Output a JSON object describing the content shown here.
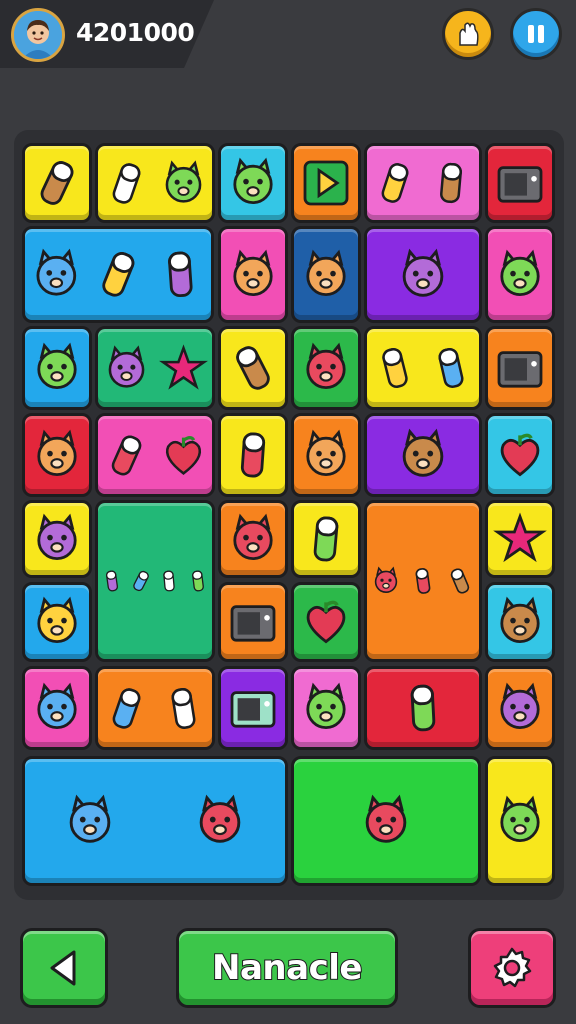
{
  "header": {
    "score": "4201000",
    "avatar_icon": "player-avatar",
    "boost_icon": "flame-hand-icon",
    "pause_icon": "pause-icon"
  },
  "colors": {
    "yellow": "#f8e71c",
    "cyan": "#34c6e6",
    "orange": "#f7831e",
    "pink": "#f06bd1",
    "red": "#e3263b",
    "blue": "#23a8ec",
    "magenta": "#f24fb5",
    "navy": "#1f5fa8",
    "purple": "#8a2be2",
    "green": "#2cb94a",
    "teal": "#22b877",
    "lime": "#2ad23e"
  },
  "tiles": [
    {
      "name": "tile-fan-yellow",
      "color": "yellow",
      "icons": [
        "fan-icon"
      ]
    },
    {
      "name": "tile-glove-ghost-yellow",
      "color": "yellow",
      "icons": [
        "glove-icon",
        "ghost-icon"
      ]
    },
    {
      "name": "tile-octopus-cyan",
      "color": "cyan",
      "icons": [
        "octopus-icon"
      ]
    },
    {
      "name": "tile-play-orange",
      "color": "orange",
      "icons": [
        "play-icon"
      ]
    },
    {
      "name": "tile-bottles-pink",
      "color": "pink",
      "icons": [
        "spray-bottle-icon",
        "battery-icon"
      ]
    },
    {
      "name": "tile-radio-red",
      "color": "red",
      "icons": [
        "radio-icon"
      ]
    },
    {
      "name": "tile-cat-tools-blue",
      "color": "blue",
      "icons": [
        "cat-icon",
        "fork-icon",
        "lollipop-icon"
      ]
    },
    {
      "name": "tile-frog-magenta",
      "color": "magenta",
      "icons": [
        "frog-icon"
      ]
    },
    {
      "name": "tile-bird-navy",
      "color": "navy",
      "icons": [
        "bird-icon"
      ]
    },
    {
      "name": "tile-skull-purple",
      "color": "purple",
      "icons": [
        "skull-crossbones-icon"
      ]
    },
    {
      "name": "tile-ghost-magenta",
      "color": "magenta",
      "icons": [
        "ghost-icon"
      ]
    },
    {
      "name": "tile-dog-blue",
      "color": "blue",
      "icons": [
        "dog-icon"
      ]
    },
    {
      "name": "tile-shapes-teal",
      "color": "teal",
      "icons": [
        "avocado-icon",
        "star-icon"
      ]
    },
    {
      "name": "tile-cup-yellow",
      "color": "yellow",
      "icons": [
        "cup-icon"
      ]
    },
    {
      "name": "tile-face-green",
      "color": "green",
      "icons": [
        "face-icon"
      ]
    },
    {
      "name": "tile-pills-yellow",
      "color": "yellow",
      "icons": [
        "pill-icon",
        "candy-icon"
      ]
    },
    {
      "name": "tile-microwave-orange",
      "color": "orange",
      "icons": [
        "microwave-icon"
      ]
    },
    {
      "name": "tile-bunny-red",
      "color": "red",
      "icons": [
        "bunny-icon"
      ]
    },
    {
      "name": "tile-plants-magenta",
      "color": "magenta",
      "icons": [
        "cactus-icon",
        "strawberry-icon"
      ]
    },
    {
      "name": "tile-shield-yellow",
      "color": "yellow",
      "icons": [
        "shield-icon"
      ]
    },
    {
      "name": "tile-puzzle-orange",
      "color": "orange",
      "icons": [
        "puzzle-icon"
      ]
    },
    {
      "name": "tile-fish-purple",
      "color": "purple",
      "icons": [
        "fish-icon"
      ]
    },
    {
      "name": "tile-apple-cyan",
      "color": "cyan",
      "icons": [
        "apple-icon"
      ]
    },
    {
      "name": "tile-bear-yellow",
      "color": "yellow",
      "icons": [
        "bear-icon"
      ]
    },
    {
      "name": "tile-tools-teal",
      "color": "teal",
      "icons": [
        "hook-icon",
        "seven-icon",
        "axe-icon",
        "capsule-icon"
      ]
    },
    {
      "name": "tile-lion-orange",
      "color": "orange",
      "icons": [
        "lion-icon"
      ]
    },
    {
      "name": "tile-boot-yellow",
      "color": "yellow",
      "icons": [
        "boot-icon"
      ]
    },
    {
      "name": "tile-whale-orange",
      "color": "orange",
      "icons": [
        "whale-icon",
        "flask-icon",
        "bag-icon"
      ]
    },
    {
      "name": "tile-star-yellow",
      "color": "yellow",
      "icons": [
        "star-icon"
      ]
    },
    {
      "name": "tile-boy-blue",
      "color": "blue",
      "icons": [
        "boy-icon"
      ]
    },
    {
      "name": "tile-suitcase-orange",
      "color": "orange",
      "icons": [
        "suitcase-icon"
      ]
    },
    {
      "name": "tile-heart-green",
      "color": "green",
      "icons": [
        "heart-icon"
      ]
    },
    {
      "name": "tile-alien-cyan",
      "color": "cyan",
      "icons": [
        "alien-icon"
      ]
    },
    {
      "name": "tile-cat-magenta",
      "color": "magenta",
      "icons": [
        "cat-icon"
      ]
    },
    {
      "name": "tile-needle-orange",
      "color": "orange",
      "icons": [
        "pen-icon",
        "trowel-icon"
      ]
    },
    {
      "name": "tile-phone-purple",
      "color": "purple",
      "icons": [
        "phone-icon"
      ]
    },
    {
      "name": "tile-monkey-pink",
      "color": "pink",
      "icons": [
        "monkey-icon"
      ]
    },
    {
      "name": "tile-icecream-red",
      "color": "red",
      "icons": [
        "icecream-icon"
      ]
    },
    {
      "name": "tile-controller-orange",
      "color": "orange",
      "icons": [
        "controller-icon"
      ]
    },
    {
      "name": "tile-giraffe-horse-blue",
      "color": "blue",
      "icons": [
        "sock-icon",
        "horse-icon"
      ]
    },
    {
      "name": "tile-goat-lime",
      "color": "lime",
      "icons": [
        "goat-balloon-icon"
      ]
    },
    {
      "name": "tile-pig-yellow",
      "color": "yellow",
      "icons": [
        "pig-icon"
      ]
    }
  ],
  "footer": {
    "back_icon": "arrow-left-icon",
    "main_label": "Nanacle",
    "settings_icon": "gear-icon"
  }
}
